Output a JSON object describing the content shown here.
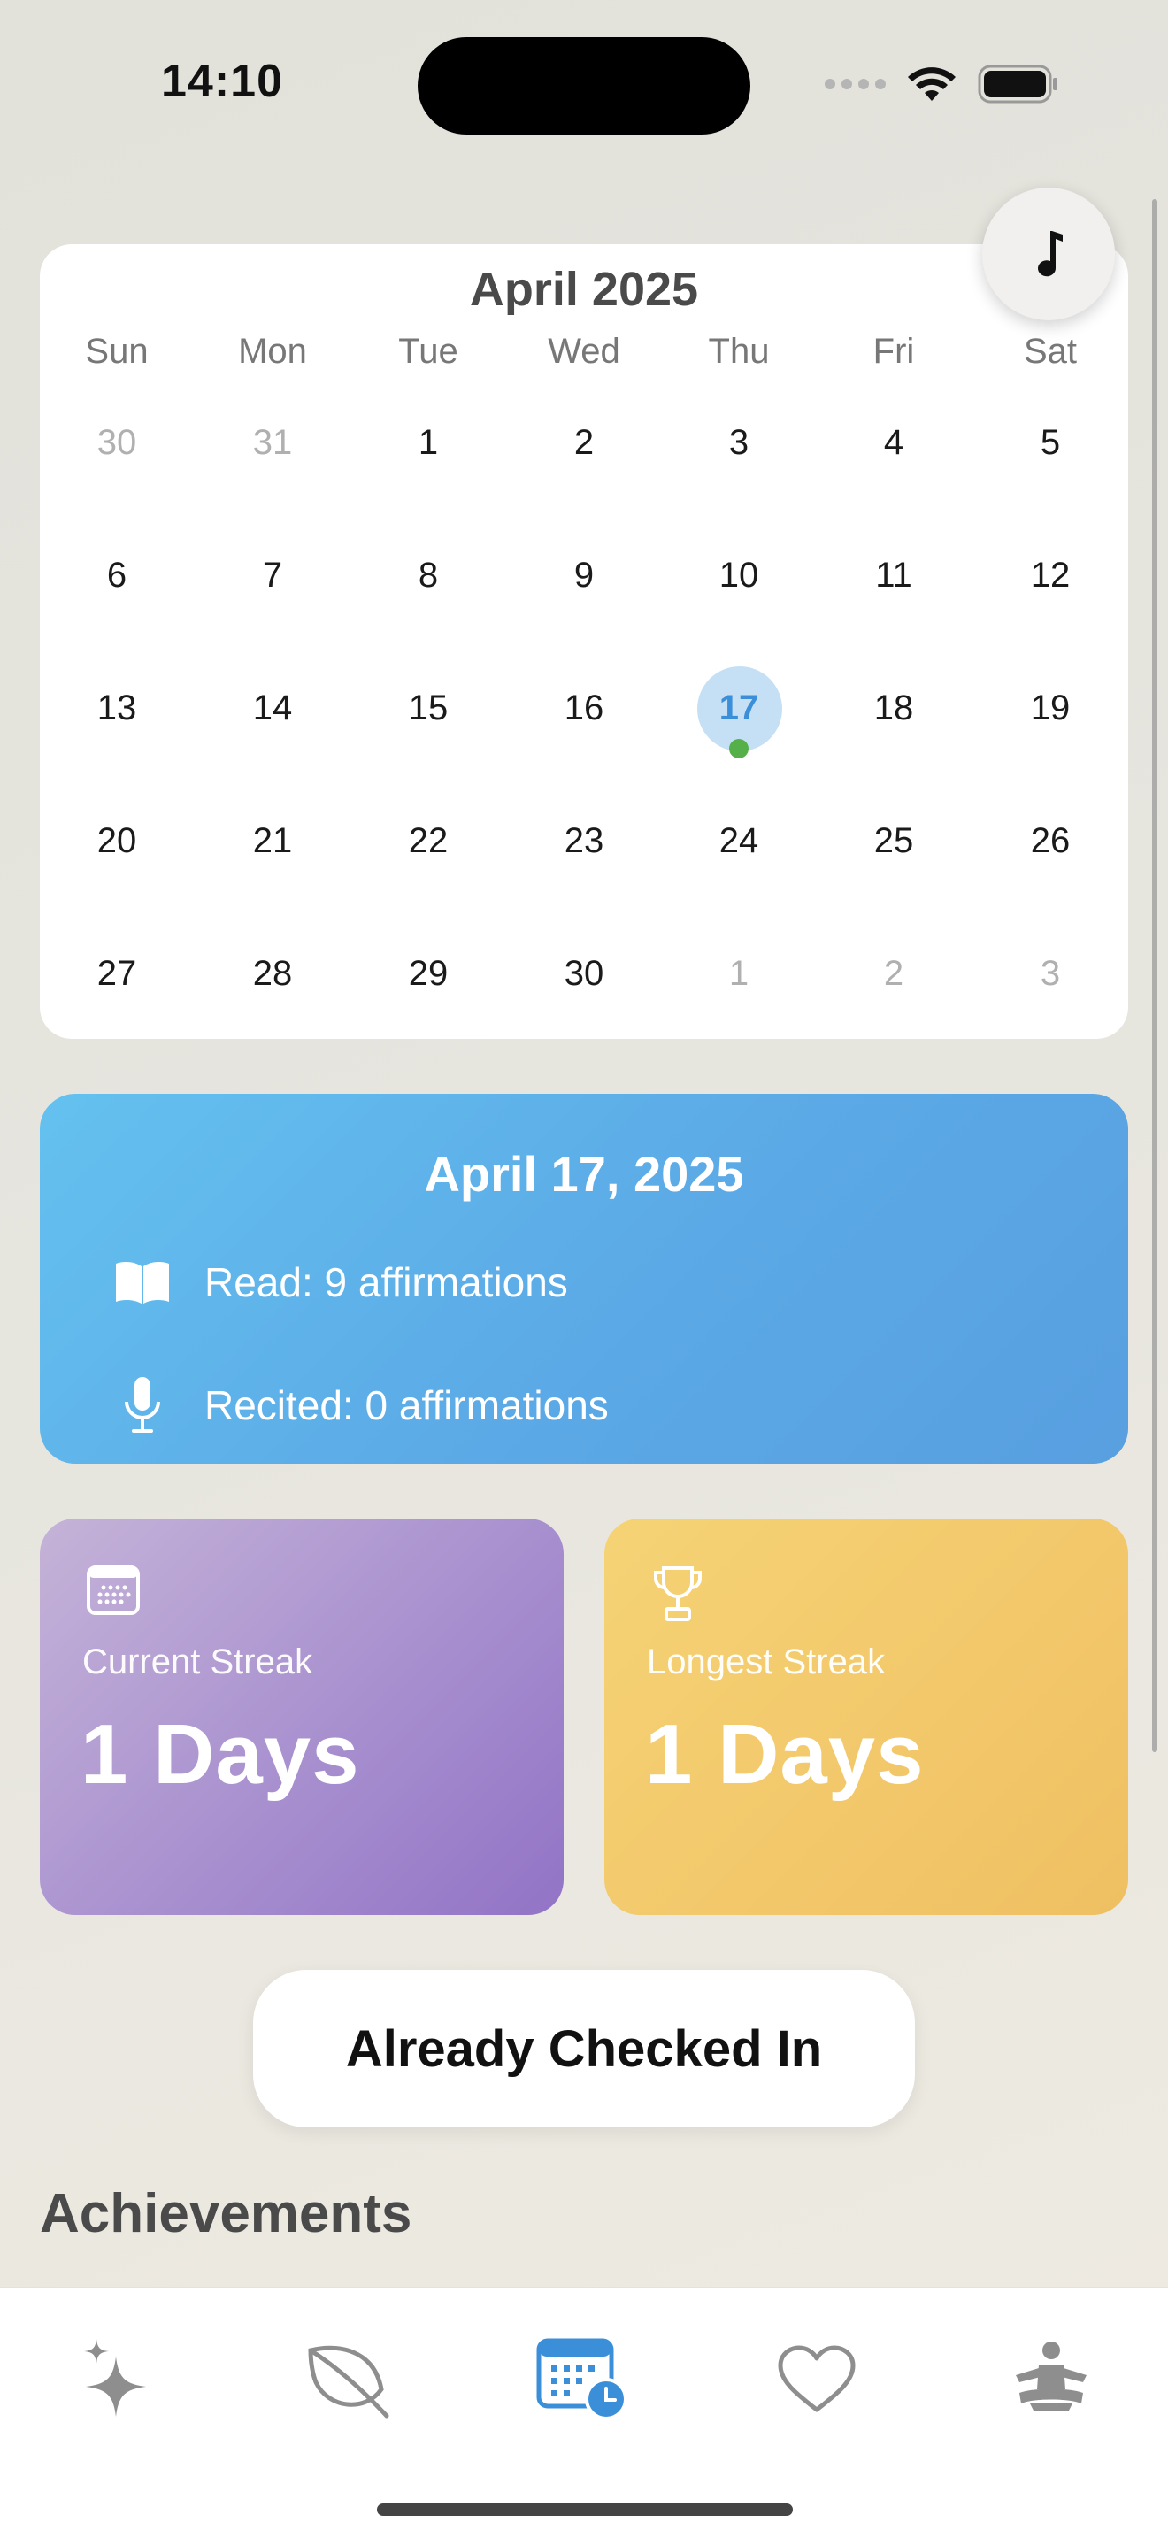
{
  "status_bar": {
    "time": "14:10"
  },
  "calendar": {
    "month_title": "April 2025",
    "weekdays": [
      "Sun",
      "Mon",
      "Tue",
      "Wed",
      "Thu",
      "Fri",
      "Sat"
    ],
    "weeks": [
      [
        {
          "d": "30",
          "muted": true
        },
        {
          "d": "31",
          "muted": true
        },
        {
          "d": "1"
        },
        {
          "d": "2"
        },
        {
          "d": "3"
        },
        {
          "d": "4"
        },
        {
          "d": "5"
        }
      ],
      [
        {
          "d": "6"
        },
        {
          "d": "7"
        },
        {
          "d": "8"
        },
        {
          "d": "9"
        },
        {
          "d": "10"
        },
        {
          "d": "11"
        },
        {
          "d": "12"
        }
      ],
      [
        {
          "d": "13"
        },
        {
          "d": "14"
        },
        {
          "d": "15"
        },
        {
          "d": "16"
        },
        {
          "d": "17",
          "selected": true
        },
        {
          "d": "18"
        },
        {
          "d": "19"
        }
      ],
      [
        {
          "d": "20"
        },
        {
          "d": "21"
        },
        {
          "d": "22"
        },
        {
          "d": "23"
        },
        {
          "d": "24"
        },
        {
          "d": "25"
        },
        {
          "d": "26"
        }
      ],
      [
        {
          "d": "27"
        },
        {
          "d": "28"
        },
        {
          "d": "29"
        },
        {
          "d": "30"
        },
        {
          "d": "1",
          "muted": true
        },
        {
          "d": "2",
          "muted": true
        },
        {
          "d": "3",
          "muted": true
        }
      ]
    ],
    "selected_day": "17",
    "music_icon": "music-note-icon"
  },
  "summary": {
    "date": "April 17, 2025",
    "read": "Read: 9 affirmations",
    "recited": "Recited: 0 affirmations"
  },
  "streaks": {
    "current": {
      "label": "Current Streak",
      "value": "1 Days"
    },
    "longest": {
      "label": "Longest Streak",
      "value": "1 Days"
    }
  },
  "checkin_button": "Already Checked In",
  "achievements_heading": "Achievements",
  "tab_bar": {
    "tabs": [
      "sparkles-icon",
      "leaf-icon",
      "calendar-clock-icon",
      "heart-icon",
      "meditation-icon"
    ],
    "active_color": "#3b8fd9",
    "inactive_color": "#8e8e8e"
  },
  "colors": {
    "summary_gradient": [
      "#64c1ef",
      "#589fe0"
    ],
    "current_streak_gradient": [
      "#c5b3d8",
      "#9273c6"
    ],
    "longest_streak_gradient": [
      "#f5d375",
      "#efc062"
    ],
    "selected_day_bg": "#c5e0f5",
    "activity_dot": "#55b04a"
  }
}
